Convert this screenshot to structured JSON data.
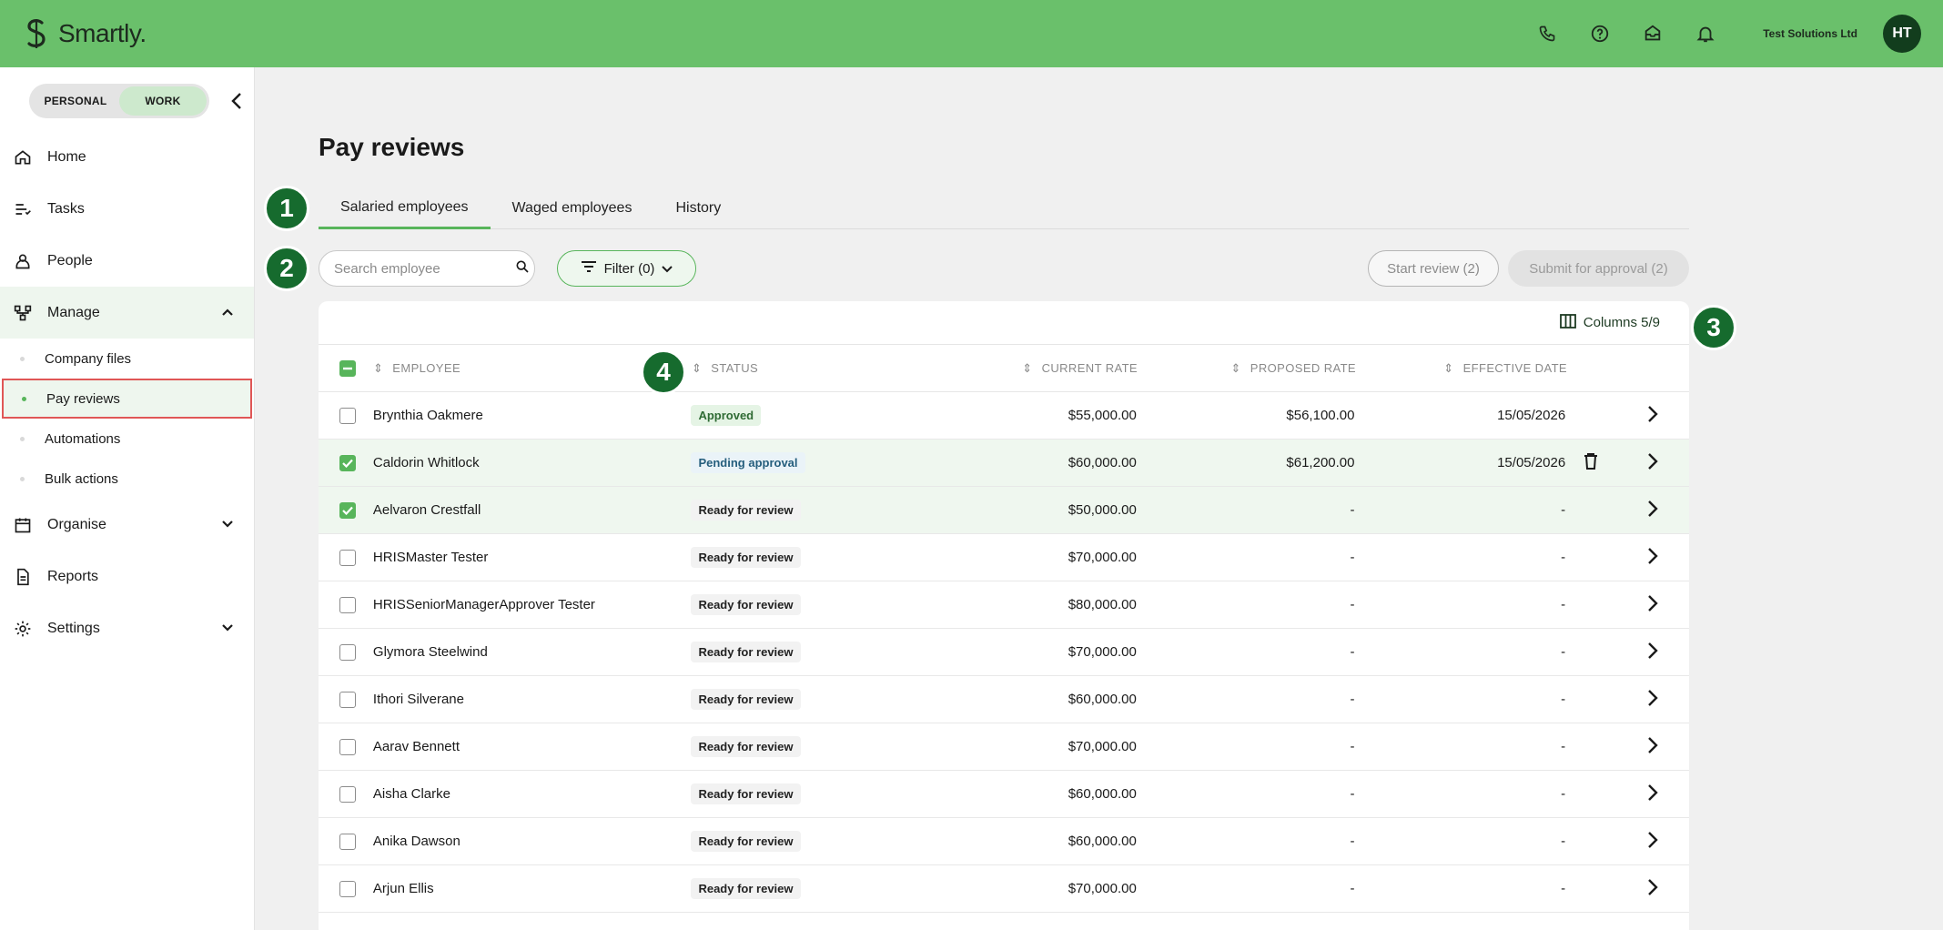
{
  "app": {
    "name": "Smartly.",
    "company": "Test Solutions Ltd",
    "avatar_initials": "HT"
  },
  "header_icons": [
    "phone-icon",
    "help-icon",
    "inbox-icon",
    "bell-icon"
  ],
  "sidebar": {
    "toggle": {
      "personal": "PERSONAL",
      "work": "WORK",
      "selected": "WORK"
    },
    "items": [
      {
        "label": "Home",
        "icon": "home-icon"
      },
      {
        "label": "Tasks",
        "icon": "tasks-icon"
      },
      {
        "label": "People",
        "icon": "person-icon"
      },
      {
        "label": "Manage",
        "icon": "manage-icon",
        "expanded": true
      },
      {
        "label": "Organise",
        "icon": "calendar-icon",
        "expanded": false
      },
      {
        "label": "Reports",
        "icon": "document-icon"
      },
      {
        "label": "Settings",
        "icon": "gear-icon",
        "expanded": false
      }
    ],
    "manage_sub": [
      {
        "label": "Company files"
      },
      {
        "label": "Pay reviews",
        "active": true
      },
      {
        "label": "Automations"
      },
      {
        "label": "Bulk actions"
      }
    ]
  },
  "page": {
    "title": "Pay reviews",
    "tabs": [
      {
        "label": "Salaried employees",
        "active": true
      },
      {
        "label": "Waged employees"
      },
      {
        "label": "History"
      }
    ],
    "badges": [
      "1",
      "2",
      "3",
      "4"
    ],
    "search": {
      "placeholder": "Search employee",
      "value": ""
    },
    "filter_label": "Filter (0)",
    "start_review_label": "Start review (2)",
    "submit_label": "Submit for approval (2)",
    "columns_label": "Columns 5/9"
  },
  "table": {
    "headers": {
      "employee": "EMPLOYEE",
      "status": "STATUS",
      "current_rate": "CURRENT RATE",
      "proposed_rate": "PROPOSED RATE",
      "effective_date": "EFFECTIVE DATE"
    },
    "rows": [
      {
        "employee": "Brynthia Oakmere",
        "status": "Approved",
        "status_kind": "approved",
        "current_rate": "$55,000.00",
        "proposed_rate": "$56,100.00",
        "effective_date": "15/05/2026",
        "checked": false,
        "delete": false
      },
      {
        "employee": "Caldorin Whitlock",
        "status": "Pending approval",
        "status_kind": "pending",
        "current_rate": "$60,000.00",
        "proposed_rate": "$61,200.00",
        "effective_date": "15/05/2026",
        "checked": true,
        "delete": true
      },
      {
        "employee": "Aelvaron Crestfall",
        "status": "Ready for review",
        "status_kind": "ready",
        "current_rate": "$50,000.00",
        "proposed_rate": "-",
        "effective_date": "-",
        "checked": true,
        "delete": false
      },
      {
        "employee": "HRISMaster Tester",
        "status": "Ready for review",
        "status_kind": "ready",
        "current_rate": "$70,000.00",
        "proposed_rate": "-",
        "effective_date": "-",
        "checked": false,
        "delete": false
      },
      {
        "employee": "HRISSeniorManagerApprover Tester",
        "status": "Ready for review",
        "status_kind": "ready",
        "current_rate": "$80,000.00",
        "proposed_rate": "-",
        "effective_date": "-",
        "checked": false,
        "delete": false
      },
      {
        "employee": "Glymora Steelwind",
        "status": "Ready for review",
        "status_kind": "ready",
        "current_rate": "$70,000.00",
        "proposed_rate": "-",
        "effective_date": "-",
        "checked": false,
        "delete": false
      },
      {
        "employee": "Ithori Silverane",
        "status": "Ready for review",
        "status_kind": "ready",
        "current_rate": "$60,000.00",
        "proposed_rate": "-",
        "effective_date": "-",
        "checked": false,
        "delete": false
      },
      {
        "employee": "Aarav Bennett",
        "status": "Ready for review",
        "status_kind": "ready",
        "current_rate": "$70,000.00",
        "proposed_rate": "-",
        "effective_date": "-",
        "checked": false,
        "delete": false
      },
      {
        "employee": "Aisha Clarke",
        "status": "Ready for review",
        "status_kind": "ready",
        "current_rate": "$60,000.00",
        "proposed_rate": "-",
        "effective_date": "-",
        "checked": false,
        "delete": false
      },
      {
        "employee": "Anika Dawson",
        "status": "Ready for review",
        "status_kind": "ready",
        "current_rate": "$60,000.00",
        "proposed_rate": "-",
        "effective_date": "-",
        "checked": false,
        "delete": false
      },
      {
        "employee": "Arjun Ellis",
        "status": "Ready for review",
        "status_kind": "ready",
        "current_rate": "$70,000.00",
        "proposed_rate": "-",
        "effective_date": "-",
        "checked": false,
        "delete": false
      }
    ]
  },
  "colors": {
    "brand": "#6ac06b",
    "accent": "#58b55b",
    "badge": "#166b2e",
    "active_outline": "#e05656"
  }
}
